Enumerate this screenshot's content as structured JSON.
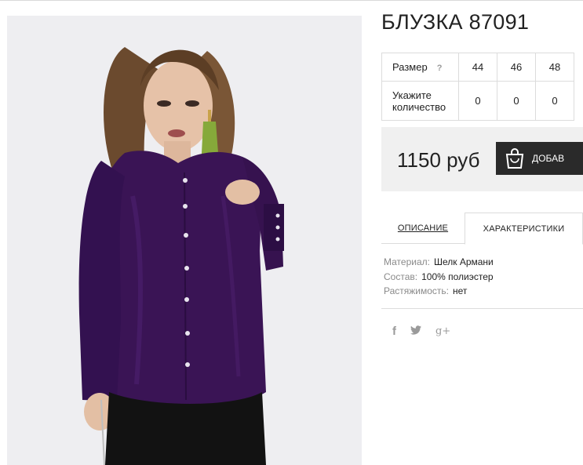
{
  "product": {
    "title": "БЛУЗКА 87091",
    "image_alt": "Purple satin blouse worn by model"
  },
  "size_table": {
    "size_label": "Размер",
    "help_icon": "?",
    "sizes": [
      "44",
      "46",
      "48"
    ],
    "qty_label": "Укажите количество",
    "quantities": [
      "0",
      "0",
      "0"
    ]
  },
  "purchase": {
    "price": "1150 руб",
    "add_button_label": "ДОБАВ",
    "bag_icon": "shopping-bag-icon"
  },
  "tabs": {
    "description_label": "ОПИСАНИЕ",
    "specs_label": "ХАРАКТЕРИСТИКИ",
    "active": "specs"
  },
  "specs": [
    {
      "label": "Материал:",
      "value": "Шелк Армани"
    },
    {
      "label": "Состав:",
      "value": "100% полиэстер"
    },
    {
      "label": "Растяжимость:",
      "value": "нет"
    }
  ],
  "social": {
    "facebook": "f",
    "twitter": "🐦",
    "googleplus": "g+"
  },
  "colors": {
    "blouse": "#3a1455",
    "button_dark": "#2a2a2a",
    "panel_bg": "#f0f0f0"
  }
}
